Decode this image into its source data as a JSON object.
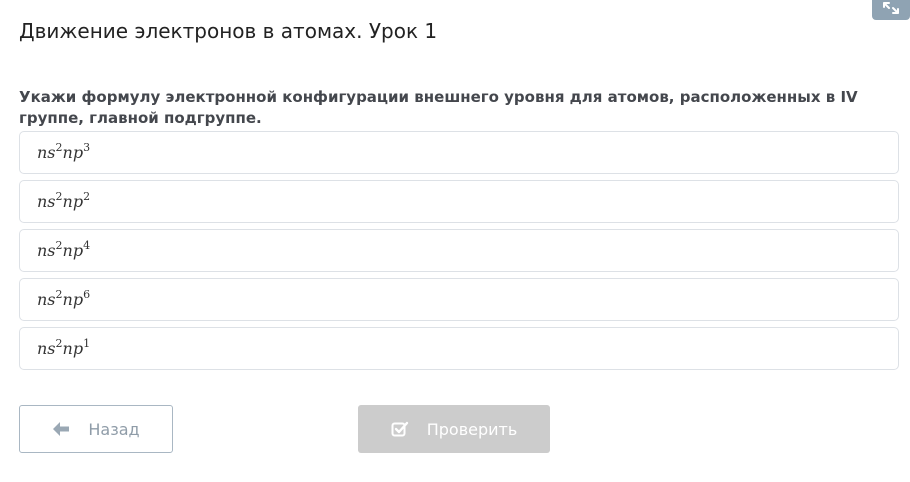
{
  "corner_button": {
    "icon": "expand-icon"
  },
  "page": {
    "title": "Движение электронов в атомах. Урок 1"
  },
  "question": {
    "text": "Укажи формулу электронной конфигурации внешнего уровня для атомов, расположенных в IV группе, главной подгруппе."
  },
  "options": [
    {
      "base1": "ns",
      "sup1": "2",
      "base2": "np",
      "sup2": "3"
    },
    {
      "base1": "ns",
      "sup1": "2",
      "base2": "np",
      "sup2": "2"
    },
    {
      "base1": "ns",
      "sup1": "2",
      "base2": "np",
      "sup2": "4"
    },
    {
      "base1": "ns",
      "sup1": "2",
      "base2": "np",
      "sup2": "6"
    },
    {
      "base1": "ns",
      "sup1": "2",
      "base2": "np",
      "sup2": "1"
    }
  ],
  "navigation": {
    "back_label": "Назад",
    "back_icon": "arrow-left-icon",
    "check_label": "Проверить",
    "check_icon": "checkbox-checked-icon"
  },
  "colors": {
    "check_button_bg": "#cccccc",
    "back_button_border": "#a9b7c3",
    "corner_button_bg": "#8fa3b3"
  }
}
